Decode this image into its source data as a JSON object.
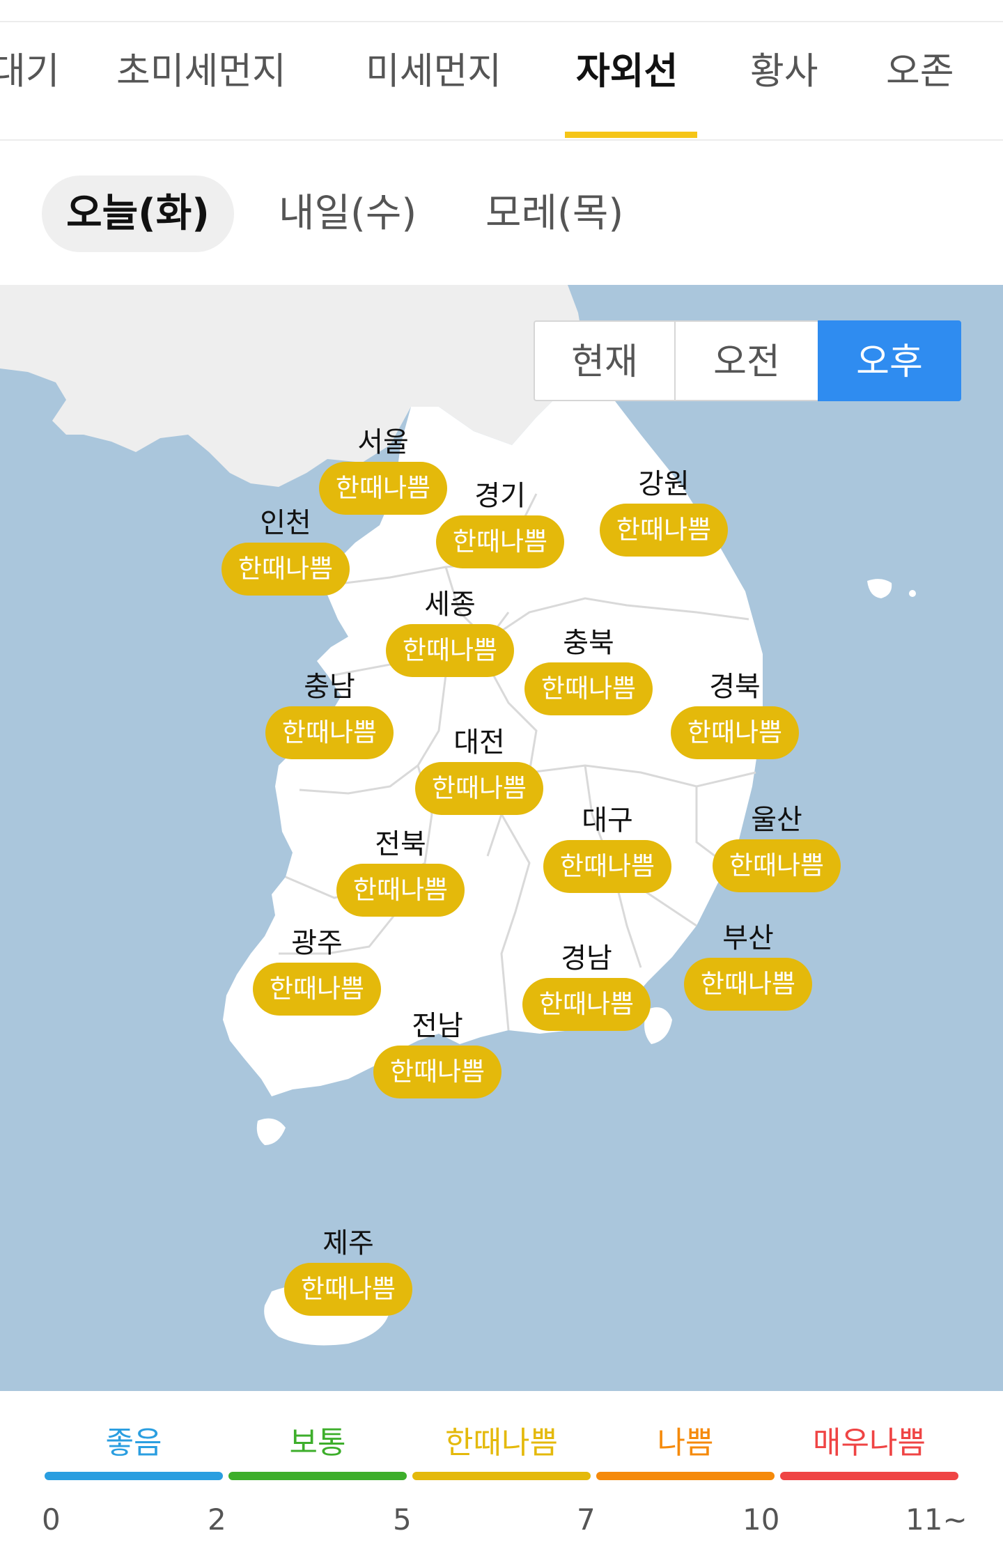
{
  "tabs": {
    "items": [
      {
        "label": "대기"
      },
      {
        "label": "초미세먼지"
      },
      {
        "label": "미세먼지"
      },
      {
        "label": "자외선"
      },
      {
        "label": "황사"
      },
      {
        "label": "오존"
      }
    ],
    "active_index": 3
  },
  "days": {
    "items": [
      {
        "label": "오늘(화)"
      },
      {
        "label": "내일(수)"
      },
      {
        "label": "모레(목)"
      }
    ],
    "active_index": 0
  },
  "time_toggle": {
    "items": [
      {
        "label": "현재"
      },
      {
        "label": "오전"
      },
      {
        "label": "오후"
      }
    ],
    "active_index": 2
  },
  "regions": [
    {
      "name": "서울",
      "status": "한때나쁨"
    },
    {
      "name": "인천",
      "status": "한때나쁨"
    },
    {
      "name": "경기",
      "status": "한때나쁨"
    },
    {
      "name": "강원",
      "status": "한때나쁨"
    },
    {
      "name": "세종",
      "status": "한때나쁨"
    },
    {
      "name": "충북",
      "status": "한때나쁨"
    },
    {
      "name": "충남",
      "status": "한때나쁨"
    },
    {
      "name": "경북",
      "status": "한때나쁨"
    },
    {
      "name": "대전",
      "status": "한때나쁨"
    },
    {
      "name": "대구",
      "status": "한때나쁨"
    },
    {
      "name": "울산",
      "status": "한때나쁨"
    },
    {
      "name": "전북",
      "status": "한때나쁨"
    },
    {
      "name": "광주",
      "status": "한때나쁨"
    },
    {
      "name": "부산",
      "status": "한때나쁨"
    },
    {
      "name": "경남",
      "status": "한때나쁨"
    },
    {
      "name": "전남",
      "status": "한때나쁨"
    },
    {
      "name": "제주",
      "status": "한때나쁨"
    }
  ],
  "legend": {
    "levels": [
      {
        "label": "좋음",
        "color": "#2a9ee0"
      },
      {
        "label": "보통",
        "color": "#3dae2b"
      },
      {
        "label": "한때나쁨",
        "color": "#e4b90b"
      },
      {
        "label": "나쁨",
        "color": "#f58a0b"
      },
      {
        "label": "매우나쁨",
        "color": "#ef4444"
      }
    ],
    "thresholds": [
      "0",
      "2",
      "5",
      "7",
      "10",
      "11~"
    ]
  },
  "colors": {
    "active_underline": "#f5c518",
    "toggle_active": "#2f8cf0",
    "badge": "#e4b90b",
    "sea": "#aac6dc",
    "land": "#ffffff",
    "foreign_land": "#eeeeee"
  }
}
